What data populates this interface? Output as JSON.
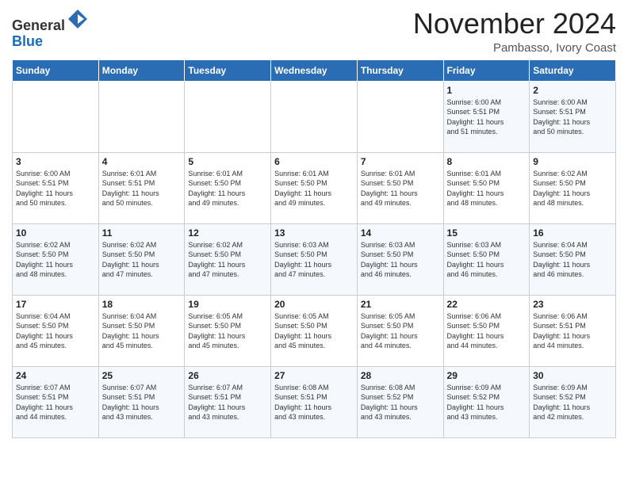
{
  "header": {
    "logo_line1": "General",
    "logo_line2": "Blue",
    "month": "November 2024",
    "location": "Pambasso, Ivory Coast"
  },
  "days_of_week": [
    "Sunday",
    "Monday",
    "Tuesday",
    "Wednesday",
    "Thursday",
    "Friday",
    "Saturday"
  ],
  "weeks": [
    [
      {
        "day": "",
        "info": ""
      },
      {
        "day": "",
        "info": ""
      },
      {
        "day": "",
        "info": ""
      },
      {
        "day": "",
        "info": ""
      },
      {
        "day": "",
        "info": ""
      },
      {
        "day": "1",
        "info": "Sunrise: 6:00 AM\nSunset: 5:51 PM\nDaylight: 11 hours\nand 51 minutes."
      },
      {
        "day": "2",
        "info": "Sunrise: 6:00 AM\nSunset: 5:51 PM\nDaylight: 11 hours\nand 50 minutes."
      }
    ],
    [
      {
        "day": "3",
        "info": "Sunrise: 6:00 AM\nSunset: 5:51 PM\nDaylight: 11 hours\nand 50 minutes."
      },
      {
        "day": "4",
        "info": "Sunrise: 6:01 AM\nSunset: 5:51 PM\nDaylight: 11 hours\nand 50 minutes."
      },
      {
        "day": "5",
        "info": "Sunrise: 6:01 AM\nSunset: 5:50 PM\nDaylight: 11 hours\nand 49 minutes."
      },
      {
        "day": "6",
        "info": "Sunrise: 6:01 AM\nSunset: 5:50 PM\nDaylight: 11 hours\nand 49 minutes."
      },
      {
        "day": "7",
        "info": "Sunrise: 6:01 AM\nSunset: 5:50 PM\nDaylight: 11 hours\nand 49 minutes."
      },
      {
        "day": "8",
        "info": "Sunrise: 6:01 AM\nSunset: 5:50 PM\nDaylight: 11 hours\nand 48 minutes."
      },
      {
        "day": "9",
        "info": "Sunrise: 6:02 AM\nSunset: 5:50 PM\nDaylight: 11 hours\nand 48 minutes."
      }
    ],
    [
      {
        "day": "10",
        "info": "Sunrise: 6:02 AM\nSunset: 5:50 PM\nDaylight: 11 hours\nand 48 minutes."
      },
      {
        "day": "11",
        "info": "Sunrise: 6:02 AM\nSunset: 5:50 PM\nDaylight: 11 hours\nand 47 minutes."
      },
      {
        "day": "12",
        "info": "Sunrise: 6:02 AM\nSunset: 5:50 PM\nDaylight: 11 hours\nand 47 minutes."
      },
      {
        "day": "13",
        "info": "Sunrise: 6:03 AM\nSunset: 5:50 PM\nDaylight: 11 hours\nand 47 minutes."
      },
      {
        "day": "14",
        "info": "Sunrise: 6:03 AM\nSunset: 5:50 PM\nDaylight: 11 hours\nand 46 minutes."
      },
      {
        "day": "15",
        "info": "Sunrise: 6:03 AM\nSunset: 5:50 PM\nDaylight: 11 hours\nand 46 minutes."
      },
      {
        "day": "16",
        "info": "Sunrise: 6:04 AM\nSunset: 5:50 PM\nDaylight: 11 hours\nand 46 minutes."
      }
    ],
    [
      {
        "day": "17",
        "info": "Sunrise: 6:04 AM\nSunset: 5:50 PM\nDaylight: 11 hours\nand 45 minutes."
      },
      {
        "day": "18",
        "info": "Sunrise: 6:04 AM\nSunset: 5:50 PM\nDaylight: 11 hours\nand 45 minutes."
      },
      {
        "day": "19",
        "info": "Sunrise: 6:05 AM\nSunset: 5:50 PM\nDaylight: 11 hours\nand 45 minutes."
      },
      {
        "day": "20",
        "info": "Sunrise: 6:05 AM\nSunset: 5:50 PM\nDaylight: 11 hours\nand 45 minutes."
      },
      {
        "day": "21",
        "info": "Sunrise: 6:05 AM\nSunset: 5:50 PM\nDaylight: 11 hours\nand 44 minutes."
      },
      {
        "day": "22",
        "info": "Sunrise: 6:06 AM\nSunset: 5:50 PM\nDaylight: 11 hours\nand 44 minutes."
      },
      {
        "day": "23",
        "info": "Sunrise: 6:06 AM\nSunset: 5:51 PM\nDaylight: 11 hours\nand 44 minutes."
      }
    ],
    [
      {
        "day": "24",
        "info": "Sunrise: 6:07 AM\nSunset: 5:51 PM\nDaylight: 11 hours\nand 44 minutes."
      },
      {
        "day": "25",
        "info": "Sunrise: 6:07 AM\nSunset: 5:51 PM\nDaylight: 11 hours\nand 43 minutes."
      },
      {
        "day": "26",
        "info": "Sunrise: 6:07 AM\nSunset: 5:51 PM\nDaylight: 11 hours\nand 43 minutes."
      },
      {
        "day": "27",
        "info": "Sunrise: 6:08 AM\nSunset: 5:51 PM\nDaylight: 11 hours\nand 43 minutes."
      },
      {
        "day": "28",
        "info": "Sunrise: 6:08 AM\nSunset: 5:52 PM\nDaylight: 11 hours\nand 43 minutes."
      },
      {
        "day": "29",
        "info": "Sunrise: 6:09 AM\nSunset: 5:52 PM\nDaylight: 11 hours\nand 43 minutes."
      },
      {
        "day": "30",
        "info": "Sunrise: 6:09 AM\nSunset: 5:52 PM\nDaylight: 11 hours\nand 42 minutes."
      }
    ]
  ]
}
